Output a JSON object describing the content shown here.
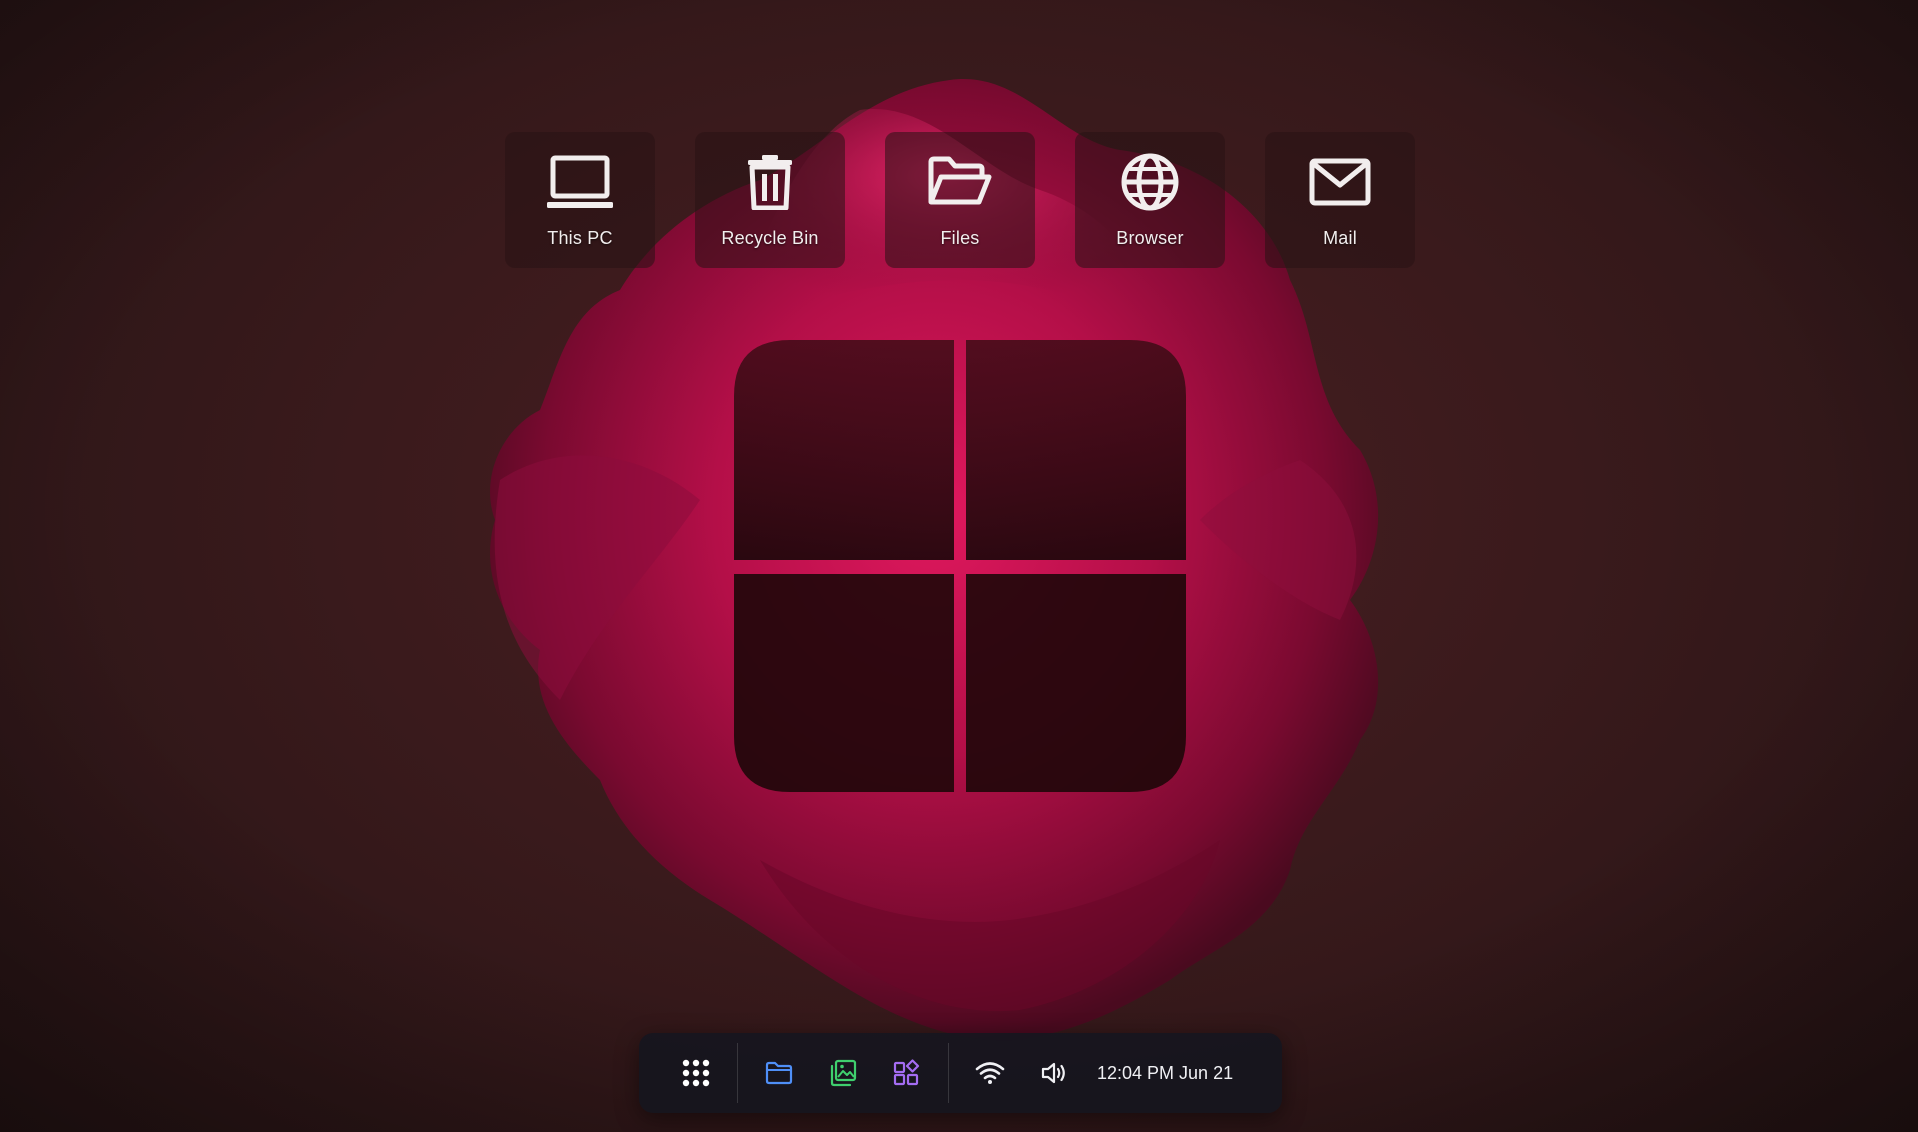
{
  "desktop": {
    "icons": [
      {
        "label": "This PC",
        "icon": "laptop-icon"
      },
      {
        "label": "Recycle Bin",
        "icon": "trash-icon"
      },
      {
        "label": "Files",
        "icon": "folder-open-icon"
      },
      {
        "label": "Browser",
        "icon": "globe-icon"
      },
      {
        "label": "Mail",
        "icon": "mail-icon"
      }
    ]
  },
  "taskbar": {
    "apps": [
      {
        "icon": "app-grid-icon",
        "color": "#ffffff"
      },
      {
        "icon": "folder-icon",
        "color": "#4f8ff7"
      },
      {
        "icon": "gallery-icon",
        "color": "#3fcf6e"
      },
      {
        "icon": "widgets-icon",
        "color": "#a46cf2"
      }
    ],
    "tray": [
      {
        "icon": "wifi-icon"
      },
      {
        "icon": "volume-icon"
      }
    ],
    "clock": "12:04 PM Jun 21"
  },
  "colors": {
    "wallpaper_bg": "#3a1a1c",
    "flower": "#b8104a",
    "taskbar_bg": "#16161e"
  }
}
